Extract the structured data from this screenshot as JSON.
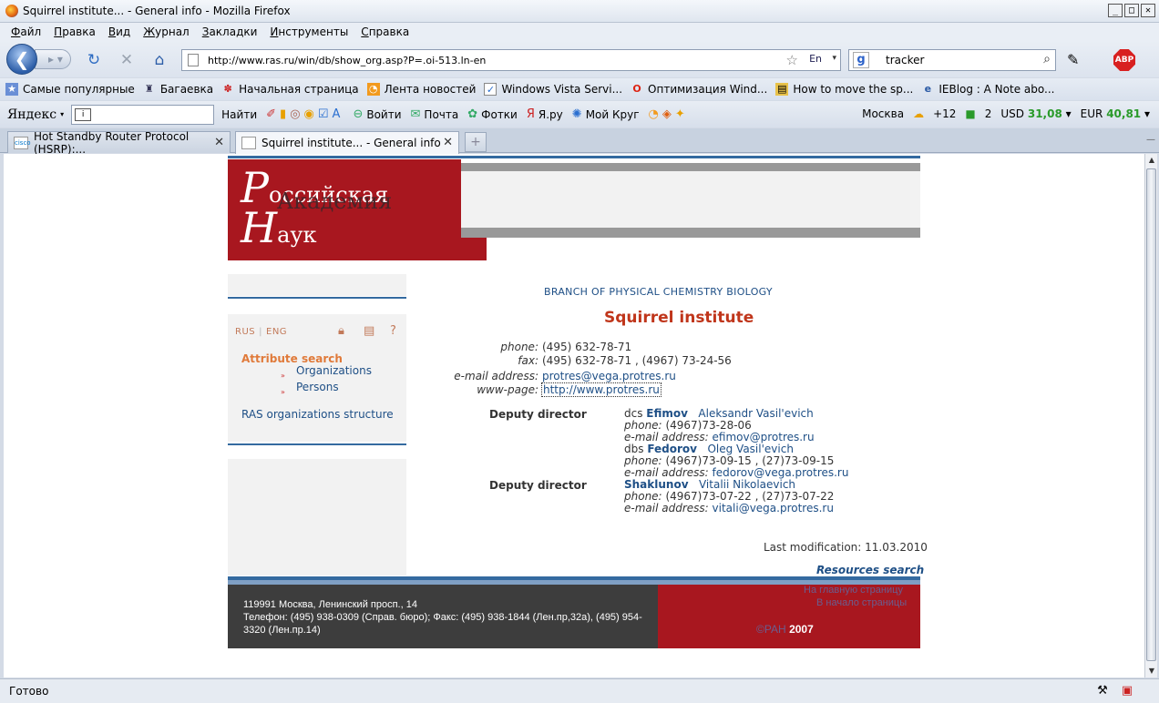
{
  "window": {
    "title": "Squirrel institute... - General info - Mozilla Firefox"
  },
  "menu": [
    "Файл",
    "Правка",
    "Вид",
    "Журнал",
    "Закладки",
    "Инструменты",
    "Справка"
  ],
  "nav": {
    "url": "http://www.ras.ru/win/db/show_org.asp?P=.oi-513.ln-en",
    "lang_badge": "En",
    "search_value": "tracker"
  },
  "bookmarks": [
    "Самые популярные",
    "Багаевка",
    "Начальная страница",
    "Лента новостей",
    "Windows Vista Servi...",
    "Оптимизация Wind...",
    "How to move the sp...",
    "IEBlog : A Note abo..."
  ],
  "yandex": {
    "logo": "Яндекс",
    "find": "Найти",
    "items": [
      "Войти",
      "Почта",
      "Фотки",
      "Я.ру",
      "Мой Круг"
    ],
    "city": "Москва",
    "temp": "+12",
    "count": "2",
    "usd_label": "USD",
    "usd_value": "31,08",
    "eur_label": "EUR",
    "eur_value": "40,81"
  },
  "tabs": [
    {
      "label": "Hot Standby Router Protocol (HSRP):...",
      "favicon": "cisco"
    },
    {
      "label": "Squirrel institute... - General info"
    }
  ],
  "status": {
    "text": "Готово"
  },
  "page": {
    "logo": {
      "l1_cap": "Р",
      "l1_rest": "оссийская",
      "l2": "Академия",
      "l3_cap": "Н",
      "l3_rest": "аук"
    },
    "lang_rus": "RUS",
    "lang_eng": "ENG",
    "attribute_search": "Attribute search",
    "side_links": [
      "Organizations",
      "Persons"
    ],
    "ras_structure": "RAS organizations structure",
    "branch": "BRANCH OF PHYSICAL CHEMISTRY BIOLOGY",
    "org_name": "Squirrel institute",
    "info": [
      {
        "label": "phone:",
        "value": "(495) 632-78-71"
      },
      {
        "label": "fax:",
        "value": "(495) 632-78-71 , (4967) 73-24-56"
      },
      {
        "label": "e-mail address:",
        "value": "protres@vega.protres.ru"
      },
      {
        "label": "www-page:",
        "value": "http://www.protres.ru"
      }
    ],
    "role": "Deputy director",
    "people": [
      {
        "title": "dcs",
        "last": "Efimov",
        "first": "Aleksandr Vasil'evich",
        "phone": "(4967)73-28-06",
        "email": "efimov@protres.ru"
      },
      {
        "title": "dbs",
        "last": "Fedorov",
        "first": "Oleg Vasil'evich",
        "phone": "(4967)73-09-15 , (27)73-09-15",
        "email": "fedorov@vega.protres.ru"
      },
      {
        "title": "",
        "last": "Shaklunov",
        "first": "Vitalii Nikolaevich",
        "phone": "(4967)73-07-22 , (27)73-07-22",
        "email": "vitali@vega.protres.ru"
      }
    ],
    "phone_label": "phone:",
    "email_label": "e-mail address:",
    "last_modification": "Last modification: 11.03.2010",
    "resources_search": "Resources search",
    "footer": {
      "address": "119991 Москва, Ленинский просп., 14",
      "phones": "Телефон: (495) 938-0309 (Справ. бюро); Факс: (495) 938-1844 (Лен.пр,32а), (495) 954-3320 (Лен.пр.14)",
      "link_home": "На главную страницу",
      "link_top": "В начало страницы",
      "copyright": "©РАН",
      "year": "2007"
    }
  },
  "colors": {
    "ras_red": "#a8171f",
    "link_blue": "#1e4f86",
    "title_red": "#c0361b",
    "accent_orange": "#e07a3a"
  }
}
